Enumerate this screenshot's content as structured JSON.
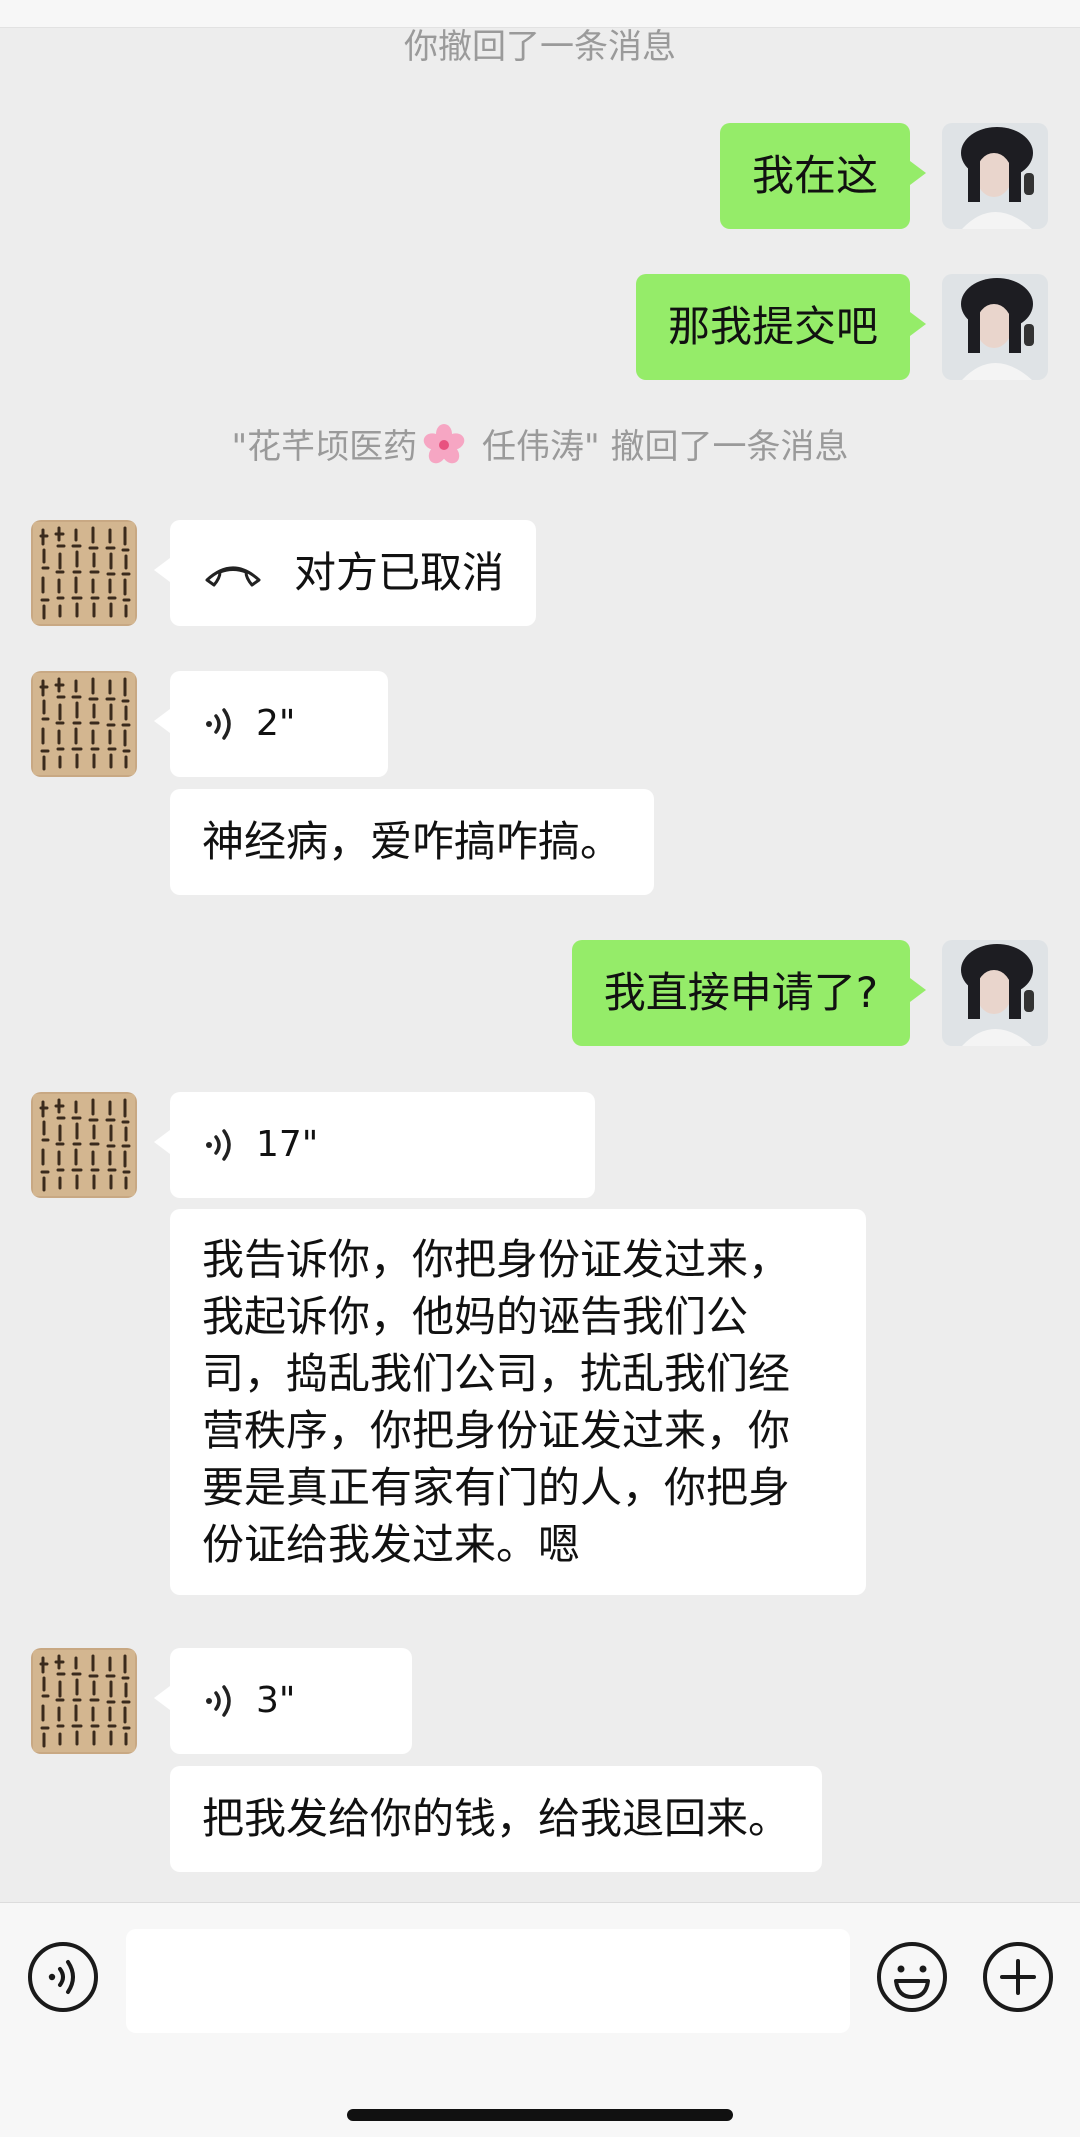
{
  "system_msgs": {
    "recall_self": "你撤回了一条消息",
    "recall_other_prefix": "\"花芊顷医药",
    "recall_other_suffix": " 任伟涛\" 撤回了一条消息"
  },
  "messages": [
    {
      "id": "m1",
      "side": "right",
      "kind": "text",
      "text": "我在这"
    },
    {
      "id": "m2",
      "side": "right",
      "kind": "text",
      "text": "那我提交吧"
    },
    {
      "id": "m3",
      "side": "left",
      "kind": "call",
      "text": "对方已取消",
      "icon": "phone-hangup-icon"
    },
    {
      "id": "m4",
      "side": "left",
      "kind": "voice",
      "duration": "2\"",
      "icon": "voice-wave-icon"
    },
    {
      "id": "m5",
      "side": "left",
      "kind": "transcript",
      "text": "神经病，爱咋搞咋搞。"
    },
    {
      "id": "m6",
      "side": "right",
      "kind": "text",
      "text": "我直接申请了?"
    },
    {
      "id": "m7",
      "side": "left",
      "kind": "voice",
      "duration": "17\"",
      "icon": "voice-wave-icon"
    },
    {
      "id": "m8",
      "side": "left",
      "kind": "transcript",
      "text": "我告诉你，你把身份证发过来，\n我起诉你，他妈的诬告我们公\n司，捣乱我们公司，扰乱我们经\n营秩序，你把身份证发过来，你\n要是真正有家有门的人，你把身\n份证给我发过来。嗯"
    },
    {
      "id": "m9",
      "side": "left",
      "kind": "voice",
      "duration": "3\"",
      "icon": "voice-wave-icon"
    },
    {
      "id": "m10",
      "side": "left",
      "kind": "transcript",
      "text": "把我发给你的钱，给我退回来。"
    }
  ],
  "input_bar": {
    "input_value": "",
    "icons": [
      "voice-input-icon",
      "emoji-icon",
      "plus-icon"
    ]
  },
  "colors": {
    "background": "#ededed",
    "bubble_green": "#95ec69",
    "bubble_white": "#ffffff",
    "system_text": "#9a9a9a"
  }
}
